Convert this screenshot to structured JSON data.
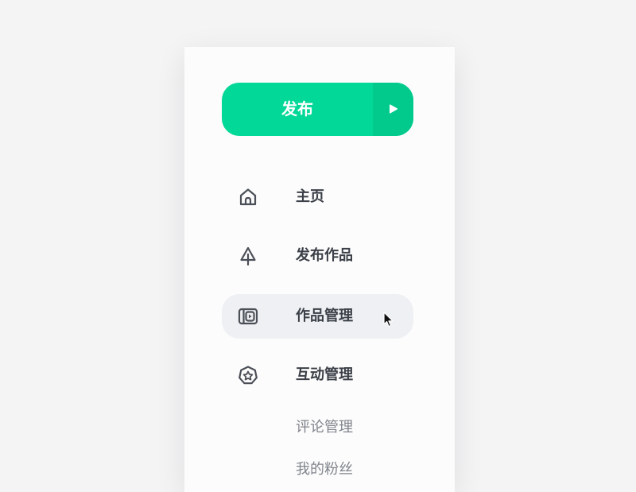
{
  "publish": {
    "label": "发布",
    "side_icon": "play-icon",
    "accent": "#02d897"
  },
  "nav": {
    "items": [
      {
        "label": "主页",
        "icon": "home-icon"
      },
      {
        "label": "发布作品",
        "icon": "tree-icon"
      },
      {
        "label": "作品管理",
        "icon": "video-library-icon",
        "active": true
      },
      {
        "label": "互动管理",
        "icon": "star-badge-icon"
      }
    ],
    "sub_items": [
      {
        "label": "评论管理"
      },
      {
        "label": "我的粉丝"
      }
    ]
  }
}
